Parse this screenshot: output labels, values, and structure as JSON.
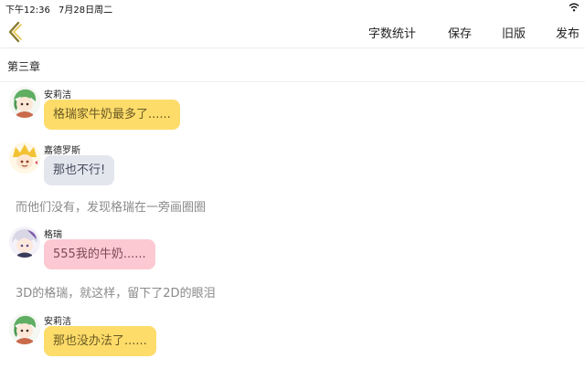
{
  "status": {
    "time": "下午12:36",
    "date": "7月28日周二"
  },
  "nav": {
    "word_count": "字数统计",
    "save": "保存",
    "history": "旧版",
    "publish": "发布"
  },
  "chapter": {
    "title": "第三章"
  },
  "colors": {
    "bubble_yellow": "#fddc6a",
    "bubble_gray": "#e4e6ee",
    "bubble_pink": "#fcc9d3",
    "back_arrow": "#8a7a2e",
    "narration_text": "#8a8a8a"
  },
  "messages": [
    {
      "speaker": "安莉洁",
      "text": "格瑞家牛奶最多了......",
      "style": "yellow"
    },
    {
      "speaker": "嘉德罗斯",
      "text": "那也不行!",
      "style": "gray"
    },
    {
      "narration": "而他们没有，发现格瑞在一旁画圈圈"
    },
    {
      "speaker": "格瑞",
      "text": "555我的牛奶......",
      "style": "pink"
    },
    {
      "narration": "3D的格瑞，就这样，留下了2D的眼泪"
    },
    {
      "speaker": "安莉洁",
      "text": "那也没办法了......",
      "style": "yellow"
    }
  ]
}
